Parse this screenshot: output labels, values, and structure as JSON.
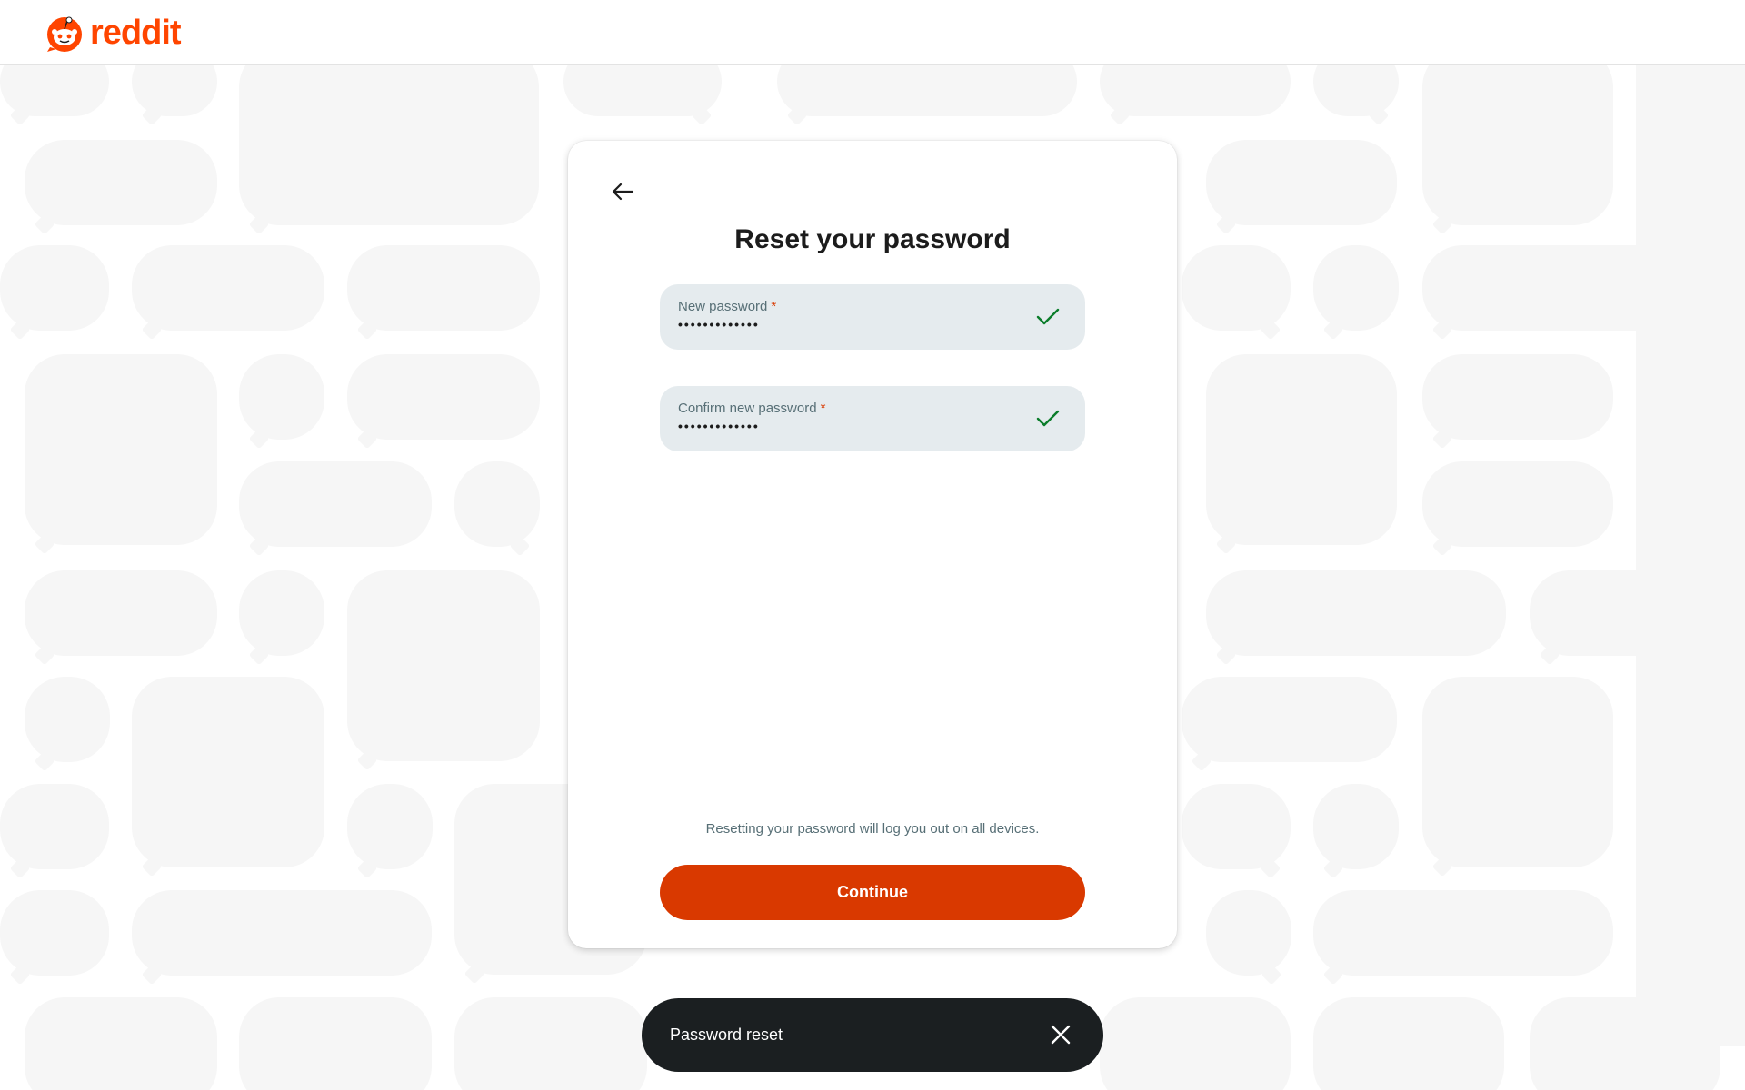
{
  "header": {
    "brand": "reddit",
    "logo_icon": "reddit-snoo-icon",
    "brand_color": "#ff4500"
  },
  "card": {
    "back_icon": "arrow-left-icon",
    "title": "Reset your password",
    "fields": [
      {
        "label": "New password",
        "required_mark": "*",
        "value_masked": "•••••••••••••",
        "status_icon": "check-icon"
      },
      {
        "label": "Confirm new password",
        "required_mark": "*",
        "value_masked": "•••••••••••••",
        "status_icon": "check-icon"
      }
    ],
    "note": "Resetting your password will log you out on all devices.",
    "continue_label": "Continue",
    "accent_color": "#d93900"
  },
  "toast": {
    "message": "Password reset",
    "close_icon": "close-icon"
  }
}
